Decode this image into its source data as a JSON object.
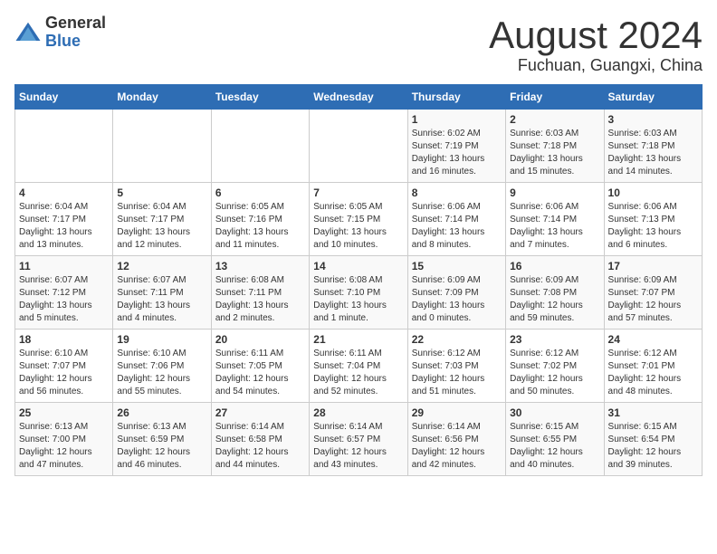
{
  "header": {
    "logo_general": "General",
    "logo_blue": "Blue",
    "title": "August 2024",
    "subtitle": "Fuchuan, Guangxi, China"
  },
  "weekdays": [
    "Sunday",
    "Monday",
    "Tuesday",
    "Wednesday",
    "Thursday",
    "Friday",
    "Saturday"
  ],
  "weeks": [
    [
      {
        "day": "",
        "info": ""
      },
      {
        "day": "",
        "info": ""
      },
      {
        "day": "",
        "info": ""
      },
      {
        "day": "",
        "info": ""
      },
      {
        "day": "1",
        "info": "Sunrise: 6:02 AM\nSunset: 7:19 PM\nDaylight: 13 hours\nand 16 minutes."
      },
      {
        "day": "2",
        "info": "Sunrise: 6:03 AM\nSunset: 7:18 PM\nDaylight: 13 hours\nand 15 minutes."
      },
      {
        "day": "3",
        "info": "Sunrise: 6:03 AM\nSunset: 7:18 PM\nDaylight: 13 hours\nand 14 minutes."
      }
    ],
    [
      {
        "day": "4",
        "info": "Sunrise: 6:04 AM\nSunset: 7:17 PM\nDaylight: 13 hours\nand 13 minutes."
      },
      {
        "day": "5",
        "info": "Sunrise: 6:04 AM\nSunset: 7:17 PM\nDaylight: 13 hours\nand 12 minutes."
      },
      {
        "day": "6",
        "info": "Sunrise: 6:05 AM\nSunset: 7:16 PM\nDaylight: 13 hours\nand 11 minutes."
      },
      {
        "day": "7",
        "info": "Sunrise: 6:05 AM\nSunset: 7:15 PM\nDaylight: 13 hours\nand 10 minutes."
      },
      {
        "day": "8",
        "info": "Sunrise: 6:06 AM\nSunset: 7:14 PM\nDaylight: 13 hours\nand 8 minutes."
      },
      {
        "day": "9",
        "info": "Sunrise: 6:06 AM\nSunset: 7:14 PM\nDaylight: 13 hours\nand 7 minutes."
      },
      {
        "day": "10",
        "info": "Sunrise: 6:06 AM\nSunset: 7:13 PM\nDaylight: 13 hours\nand 6 minutes."
      }
    ],
    [
      {
        "day": "11",
        "info": "Sunrise: 6:07 AM\nSunset: 7:12 PM\nDaylight: 13 hours\nand 5 minutes."
      },
      {
        "day": "12",
        "info": "Sunrise: 6:07 AM\nSunset: 7:11 PM\nDaylight: 13 hours\nand 4 minutes."
      },
      {
        "day": "13",
        "info": "Sunrise: 6:08 AM\nSunset: 7:11 PM\nDaylight: 13 hours\nand 2 minutes."
      },
      {
        "day": "14",
        "info": "Sunrise: 6:08 AM\nSunset: 7:10 PM\nDaylight: 13 hours\nand 1 minute."
      },
      {
        "day": "15",
        "info": "Sunrise: 6:09 AM\nSunset: 7:09 PM\nDaylight: 13 hours\nand 0 minutes."
      },
      {
        "day": "16",
        "info": "Sunrise: 6:09 AM\nSunset: 7:08 PM\nDaylight: 12 hours\nand 59 minutes."
      },
      {
        "day": "17",
        "info": "Sunrise: 6:09 AM\nSunset: 7:07 PM\nDaylight: 12 hours\nand 57 minutes."
      }
    ],
    [
      {
        "day": "18",
        "info": "Sunrise: 6:10 AM\nSunset: 7:07 PM\nDaylight: 12 hours\nand 56 minutes."
      },
      {
        "day": "19",
        "info": "Sunrise: 6:10 AM\nSunset: 7:06 PM\nDaylight: 12 hours\nand 55 minutes."
      },
      {
        "day": "20",
        "info": "Sunrise: 6:11 AM\nSunset: 7:05 PM\nDaylight: 12 hours\nand 54 minutes."
      },
      {
        "day": "21",
        "info": "Sunrise: 6:11 AM\nSunset: 7:04 PM\nDaylight: 12 hours\nand 52 minutes."
      },
      {
        "day": "22",
        "info": "Sunrise: 6:12 AM\nSunset: 7:03 PM\nDaylight: 12 hours\nand 51 minutes."
      },
      {
        "day": "23",
        "info": "Sunrise: 6:12 AM\nSunset: 7:02 PM\nDaylight: 12 hours\nand 50 minutes."
      },
      {
        "day": "24",
        "info": "Sunrise: 6:12 AM\nSunset: 7:01 PM\nDaylight: 12 hours\nand 48 minutes."
      }
    ],
    [
      {
        "day": "25",
        "info": "Sunrise: 6:13 AM\nSunset: 7:00 PM\nDaylight: 12 hours\nand 47 minutes."
      },
      {
        "day": "26",
        "info": "Sunrise: 6:13 AM\nSunset: 6:59 PM\nDaylight: 12 hours\nand 46 minutes."
      },
      {
        "day": "27",
        "info": "Sunrise: 6:14 AM\nSunset: 6:58 PM\nDaylight: 12 hours\nand 44 minutes."
      },
      {
        "day": "28",
        "info": "Sunrise: 6:14 AM\nSunset: 6:57 PM\nDaylight: 12 hours\nand 43 minutes."
      },
      {
        "day": "29",
        "info": "Sunrise: 6:14 AM\nSunset: 6:56 PM\nDaylight: 12 hours\nand 42 minutes."
      },
      {
        "day": "30",
        "info": "Sunrise: 6:15 AM\nSunset: 6:55 PM\nDaylight: 12 hours\nand 40 minutes."
      },
      {
        "day": "31",
        "info": "Sunrise: 6:15 AM\nSunset: 6:54 PM\nDaylight: 12 hours\nand 39 minutes."
      }
    ]
  ]
}
